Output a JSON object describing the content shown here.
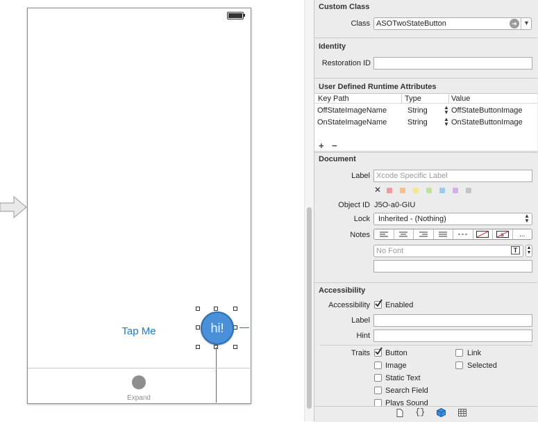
{
  "canvas": {
    "tap_label": "Tap Me",
    "hi_label": "hi!",
    "expand_label": "Expand"
  },
  "custom_class": {
    "title": "Custom Class",
    "class_label": "Class",
    "class_value": "ASOTwoStateButton"
  },
  "identity": {
    "title": "Identity",
    "restoration_label": "Restoration ID",
    "restoration_value": ""
  },
  "runtime": {
    "title": "User Defined Runtime Attributes",
    "headers": [
      "Key Path",
      "Type",
      "Value"
    ],
    "rows": [
      {
        "key": "OffStateImageName",
        "type": "String",
        "value": "OffStateButtonImage"
      },
      {
        "key": "OnStateImageName",
        "type": "String",
        "value": "OnStateButtonImage"
      }
    ],
    "add": "+",
    "remove": "−"
  },
  "document": {
    "title": "Document",
    "label_label": "Label",
    "label_placeholder": "Xcode Specific Label",
    "object_id_label": "Object ID",
    "object_id_value": "J5O-a0-GIU",
    "lock_label": "Lock",
    "lock_value": "Inherited - (Nothing)",
    "notes_label": "Notes",
    "font_placeholder": "No Font",
    "more": "..."
  },
  "accessibility": {
    "title": "Accessibility",
    "accessibility_label": "Accessibility",
    "enabled_label": "Enabled",
    "enabled_checked": true,
    "label_label": "Label",
    "hint_label": "Hint",
    "traits_label": "Traits",
    "traits": [
      {
        "label": "Button",
        "checked": true
      },
      {
        "label": "Link",
        "checked": false
      },
      {
        "label": "Image",
        "checked": false
      },
      {
        "label": "Selected",
        "checked": false
      },
      {
        "label": "Static Text",
        "checked": false
      },
      {
        "label": "Search Field",
        "checked": false
      },
      {
        "label": "Plays Sound",
        "checked": false
      }
    ]
  },
  "colors": {
    "accent_blue": "#1a7bd3",
    "button_blue": "#4a90d9",
    "swatches": [
      "#f29b9b",
      "#f5c28e",
      "#f2e88e",
      "#bfe39a",
      "#9ccbf0",
      "#d4b0e6",
      "#c4c4c4"
    ]
  }
}
